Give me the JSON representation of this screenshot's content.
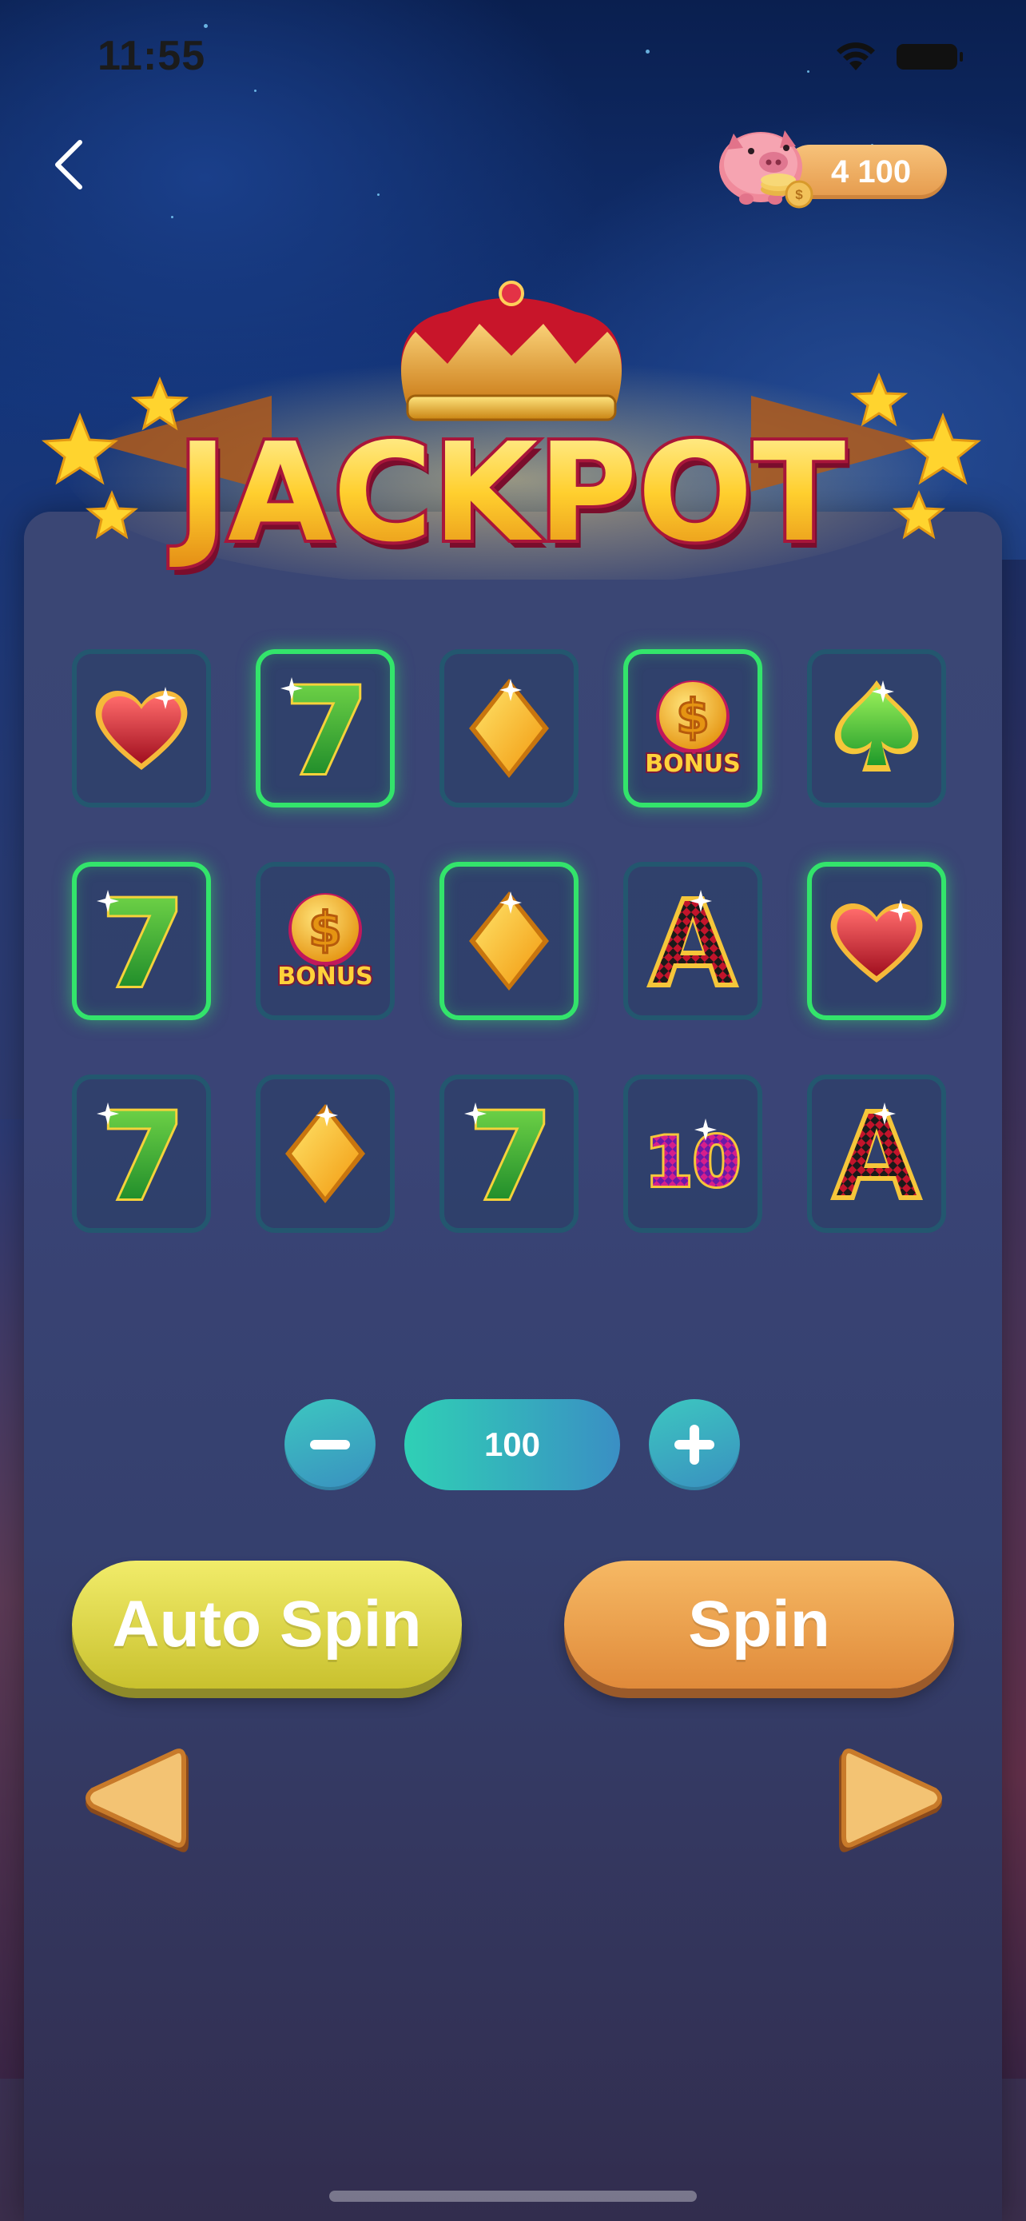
{
  "status_bar": {
    "time": "11:55"
  },
  "header": {
    "coin_balance": "4 100"
  },
  "logo": {
    "text": "JACKPOT"
  },
  "reels": {
    "rows": [
      [
        {
          "symbol": "heart",
          "win": false
        },
        {
          "symbol": "seven",
          "win": true
        },
        {
          "symbol": "diamond",
          "win": false
        },
        {
          "symbol": "bonus",
          "win": true
        },
        {
          "symbol": "spade",
          "win": false
        }
      ],
      [
        {
          "symbol": "seven",
          "win": true
        },
        {
          "symbol": "bonus",
          "win": false
        },
        {
          "symbol": "diamond",
          "win": true
        },
        {
          "symbol": "ace",
          "win": false
        },
        {
          "symbol": "heart",
          "win": true
        }
      ],
      [
        {
          "symbol": "seven",
          "win": false
        },
        {
          "symbol": "diamond",
          "win": false
        },
        {
          "symbol": "seven",
          "win": false
        },
        {
          "symbol": "ten",
          "win": false
        },
        {
          "symbol": "ace",
          "win": false
        }
      ]
    ],
    "symbol_text": {
      "seven": "7",
      "bonus_label": "BONUS",
      "bonus_sign": "$",
      "ace": "A",
      "ten": "10"
    }
  },
  "bet": {
    "value": "100"
  },
  "buttons": {
    "auto_spin": "Auto Spin",
    "spin": "Spin"
  },
  "colors": {
    "win_border": "#33e46b",
    "cell_border": "#23576f",
    "auto_spin": "#e1dc4a",
    "spin": "#eda04c",
    "bet_pill": "#2fd0b5"
  },
  "icons": [
    "back-chevron-icon",
    "piggy-bank-icon",
    "coin-icon",
    "wifi-icon",
    "battery-icon",
    "minus-icon",
    "plus-icon",
    "arrow-left-icon",
    "arrow-right-icon"
  ]
}
